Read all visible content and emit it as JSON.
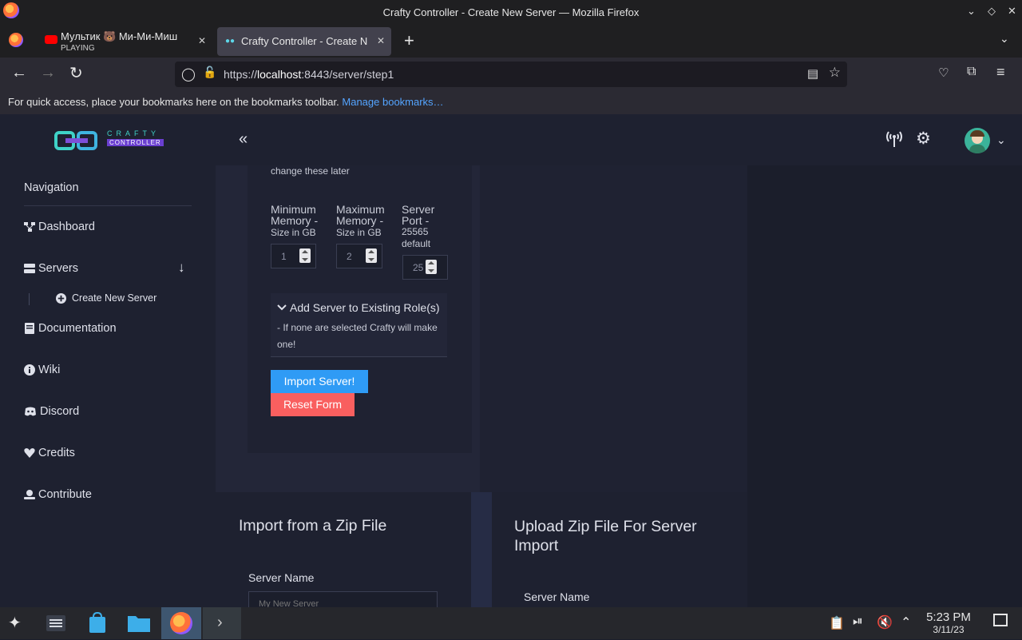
{
  "window": {
    "title": "Crafty Controller - Create New Server — Mozilla Firefox"
  },
  "tabs": [
    {
      "title": "Мультик 🐻 Ми-Ми-Миш",
      "subtitle": "PLAYING"
    },
    {
      "title": "Crafty Controller - Create N"
    }
  ],
  "urlbar": {
    "prefix": "https://",
    "host": "localhost",
    "rest": ":8443/server/step1"
  },
  "bookmarks_bar": {
    "text": "For quick access, place your bookmarks here on the bookmarks toolbar.",
    "link": "Manage bookmarks…"
  },
  "sidebar": {
    "logo_top": "CRAFTY",
    "logo_bottom": "CONTROLLER",
    "heading": "Navigation",
    "items": [
      {
        "label": "Dashboard"
      },
      {
        "label": "Servers"
      },
      {
        "label": "Create New Server"
      },
      {
        "label": "Documentation"
      },
      {
        "label": "Wiki"
      },
      {
        "label": "Discord"
      },
      {
        "label": "Credits"
      },
      {
        "label": "Contribute"
      }
    ]
  },
  "header": {
    "collapse_glyph": "«"
  },
  "form": {
    "note": "change these later",
    "min_memory": {
      "label_line1": "Minimum",
      "label_line2": "Memory -",
      "label_line3": "Size in GB",
      "value": "1"
    },
    "max_memory": {
      "label_line1": "Maximum",
      "label_line2": "Memory -",
      "label_line3": "Size in GB",
      "value": "2"
    },
    "port": {
      "label_line1": "Server",
      "label_line2": "Port -",
      "label_line3": "25565",
      "label_line4": "default",
      "value": "25"
    },
    "roles_title": "Add Server to Existing Role(s)",
    "roles_note_line1": "- If none are selected Crafty will make",
    "roles_note_line2": "one!",
    "import_label": "Import Server!",
    "reset_label": "Reset Form"
  },
  "zip_import": {
    "title": "Import from a Zip File",
    "server_name_label": "Server Name",
    "server_name_placeholder": "My New Server"
  },
  "upload_zip": {
    "title_line1": "Upload Zip File For Server",
    "title_line2": "Import",
    "server_name_label": "Server Name"
  },
  "taskbar": {
    "time": "5:23 PM",
    "date": "3/11/23"
  },
  "colors": {
    "accent_blue": "#2f9bf5",
    "reset_red": "#f95f5f",
    "sidebar_bg": "#1e2130"
  }
}
